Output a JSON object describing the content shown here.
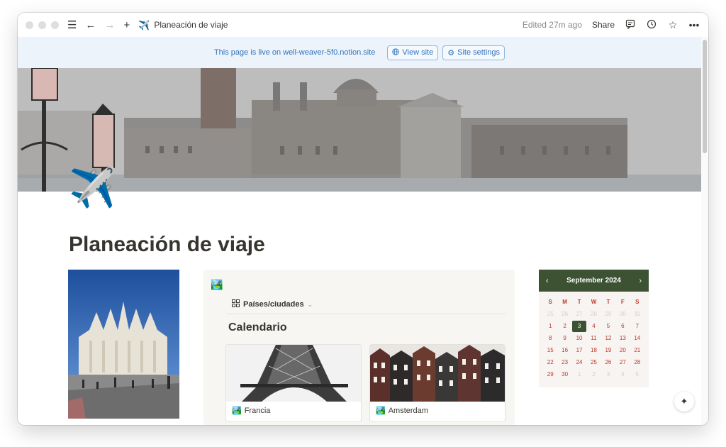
{
  "titlebar": {
    "icon": "✈️",
    "title": "Planeación de viaje",
    "edited": "Edited 27m ago",
    "share": "Share"
  },
  "banner": {
    "text": "This page is live on well-weaver-5f0.notion.site",
    "view_site": "View site",
    "site_settings": "Site settings"
  },
  "page": {
    "emoji": "✈️",
    "title": "Planeación de viaje"
  },
  "gallery": {
    "icon": "🏞️",
    "tab_label": "Países/ciudades",
    "heading": "Calendario",
    "cards": [
      {
        "icon": "🏞️",
        "label": "Francia"
      },
      {
        "icon": "🏞️",
        "label": "Amsterdam"
      }
    ]
  },
  "calendar": {
    "month": "September 2024",
    "prev": "‹",
    "next": "›",
    "weekdays": [
      "S",
      "M",
      "T",
      "W",
      "T",
      "F",
      "S"
    ],
    "days": [
      {
        "d": "25",
        "m": true
      },
      {
        "d": "26",
        "m": true
      },
      {
        "d": "27",
        "m": true
      },
      {
        "d": "28",
        "m": true
      },
      {
        "d": "29",
        "m": true
      },
      {
        "d": "30",
        "m": true
      },
      {
        "d": "31",
        "m": true
      },
      {
        "d": "1"
      },
      {
        "d": "2"
      },
      {
        "d": "3",
        "today": true
      },
      {
        "d": "4"
      },
      {
        "d": "5"
      },
      {
        "d": "6"
      },
      {
        "d": "7"
      },
      {
        "d": "8"
      },
      {
        "d": "9"
      },
      {
        "d": "10"
      },
      {
        "d": "11"
      },
      {
        "d": "12"
      },
      {
        "d": "13"
      },
      {
        "d": "14"
      },
      {
        "d": "15"
      },
      {
        "d": "16"
      },
      {
        "d": "17"
      },
      {
        "d": "18"
      },
      {
        "d": "19"
      },
      {
        "d": "20"
      },
      {
        "d": "21"
      },
      {
        "d": "22"
      },
      {
        "d": "23"
      },
      {
        "d": "24"
      },
      {
        "d": "25"
      },
      {
        "d": "26"
      },
      {
        "d": "27"
      },
      {
        "d": "28"
      },
      {
        "d": "29"
      },
      {
        "d": "30"
      },
      {
        "d": "1",
        "m": true
      },
      {
        "d": "2",
        "m": true
      },
      {
        "d": "3",
        "m": true
      },
      {
        "d": "4",
        "m": true
      },
      {
        "d": "5",
        "m": true
      }
    ]
  },
  "colors": {
    "calendar_accent": "#3c5233",
    "banner_text": "#2f74c0",
    "calendar_day_text": "#c0392b"
  }
}
